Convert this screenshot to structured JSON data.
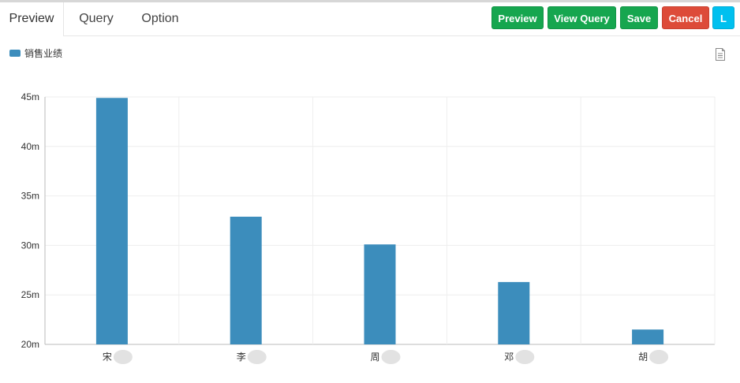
{
  "tabs": [
    {
      "label": "Preview",
      "active": true
    },
    {
      "label": "Query",
      "active": false
    },
    {
      "label": "Option",
      "active": false
    }
  ],
  "buttons": {
    "preview": "Preview",
    "view_query": "View Query",
    "save": "Save",
    "cancel": "Cancel",
    "l": "L"
  },
  "colors": {
    "bar": "#3c8dbc",
    "btn_green": "#16a64f",
    "btn_red": "#dd4b39",
    "btn_cyan": "#00c0ef"
  },
  "legend": {
    "label": "销售业绩"
  },
  "icons": {
    "export": "document-icon"
  },
  "chart_data": {
    "type": "bar",
    "categories": [
      "宋",
      "李",
      "周",
      "邓",
      "胡"
    ],
    "series": [
      {
        "name": "销售业绩",
        "values": [
          44.9,
          32.9,
          30.1,
          26.3,
          21.5
        ]
      }
    ],
    "ylim": [
      20,
      45
    ],
    "yticks": [
      "20m",
      "25m",
      "30m",
      "35m",
      "40m",
      "45m"
    ],
    "grid": true,
    "legend_position": "top-left"
  }
}
